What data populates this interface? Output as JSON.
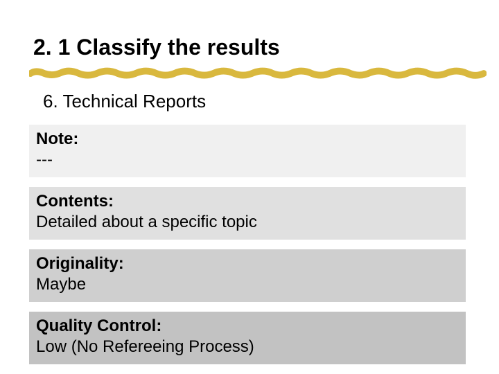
{
  "title": "2. 1 Classify the results",
  "subheading": "6.  Technical Reports",
  "sections": [
    {
      "label": "Note:",
      "value": "---"
    },
    {
      "label": "Contents:",
      "value": "Detailed about a specific topic"
    },
    {
      "label": "Originality:",
      "value": "Maybe"
    },
    {
      "label": "Quality Control:",
      "value": "Low (No Refereeing Process)"
    }
  ]
}
